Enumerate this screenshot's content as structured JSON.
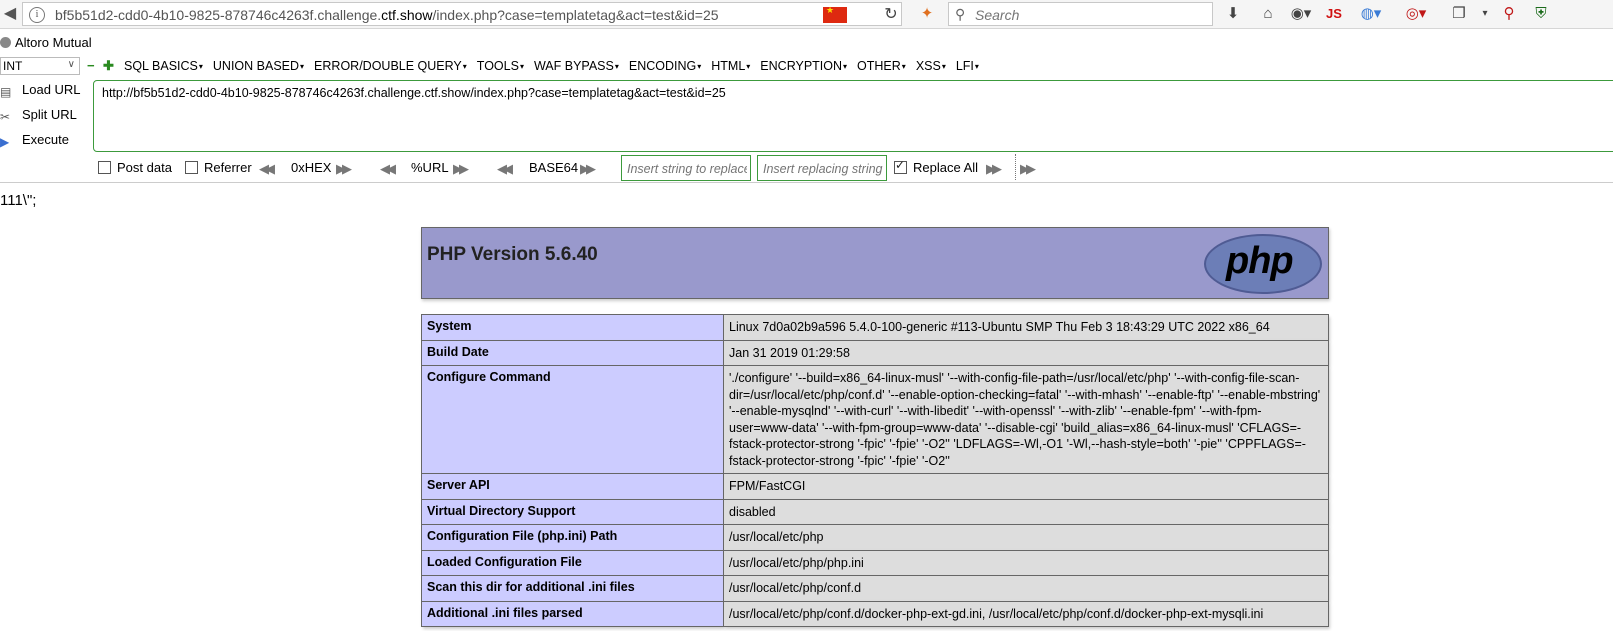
{
  "browser": {
    "url_prefix": "bf5b51d2-cdd0-4b10-9825-878746c4263f.challenge.",
    "url_domain": "ctf.show",
    "url_suffix": "/index.php?case=templatetag&act=test&id=25",
    "search_placeholder": "Search",
    "extensions": [
      "download-icon",
      "home-icon",
      "globe-icon",
      "js-icon",
      "color-icon",
      "stop-icon",
      "window-icon",
      "zoom-icon",
      "shield-icon"
    ],
    "js_label": "JS"
  },
  "bookmarks": [
    {
      "label": "Altoro Mutual"
    }
  ],
  "hackbar": {
    "type_select": "INT",
    "menus": [
      "SQL BASICS",
      "UNION BASED",
      "ERROR/DOUBLE QUERY",
      "TOOLS",
      "WAF BYPASS",
      "ENCODING",
      "HTML",
      "ENCRYPTION",
      "OTHER",
      "XSS",
      "LFI"
    ],
    "actions": {
      "load": "Load URL",
      "split": "Split URL",
      "execute": "Execute"
    },
    "url_value": "http://bf5b51d2-cdd0-4b10-9825-878746c4263f.challenge.ctf.show/index.php?case=templatetag&act=test&id=25",
    "options": {
      "post_data": "Post data",
      "referrer": "Referrer",
      "hex": "0xHEX",
      "url": "%URL",
      "base64": "BASE64",
      "replace_placeholder": "Insert string to replace",
      "replacing_placeholder": "Insert replacing string",
      "replace_all": "Replace All"
    }
  },
  "page": {
    "echo": "111\\\";",
    "php_title": "PHP Version 5.6.40",
    "php_logo": "php",
    "rows": [
      {
        "key": "System",
        "value": "Linux 7d0a02b9a596 5.4.0-100-generic #113-Ubuntu SMP Thu Feb 3 18:43:29 UTC 2022 x86_64"
      },
      {
        "key": "Build Date",
        "value": "Jan 31 2019 01:29:58"
      },
      {
        "key": "Configure Command",
        "value": "'./configure' '--build=x86_64-linux-musl' '--with-config-file-path=/usr/local/etc/php' '--with-config-file-scan-dir=/usr/local/etc/php/conf.d' '--enable-option-checking=fatal' '--with-mhash' '--enable-ftp' '--enable-mbstring' '--enable-mysqlnd' '--with-curl' '--with-libedit' '--with-openssl' '--with-zlib' '--enable-fpm' '--with-fpm-user=www-data' '--with-fpm-group=www-data' '--disable-cgi' 'build_alias=x86_64-linux-musl' 'CFLAGS=-fstack-protector-strong '-fpic' '-fpie' '-O2'' 'LDFLAGS=-Wl,-O1 '-Wl,--hash-style=both' '-pie'' 'CPPFLAGS=-fstack-protector-strong '-fpic' '-fpie' '-O2''"
      },
      {
        "key": "Server API",
        "value": "FPM/FastCGI"
      },
      {
        "key": "Virtual Directory Support",
        "value": "disabled"
      },
      {
        "key": "Configuration File (php.ini) Path",
        "value": "/usr/local/etc/php"
      },
      {
        "key": "Loaded Configuration File",
        "value": "/usr/local/etc/php/php.ini"
      },
      {
        "key": "Scan this dir for additional .ini files",
        "value": "/usr/local/etc/php/conf.d"
      },
      {
        "key": "Additional .ini files parsed",
        "value": "/usr/local/etc/php/conf.d/docker-php-ext-gd.ini, /usr/local/etc/php/conf.d/docker-php-ext-mysqli.ini"
      }
    ]
  }
}
